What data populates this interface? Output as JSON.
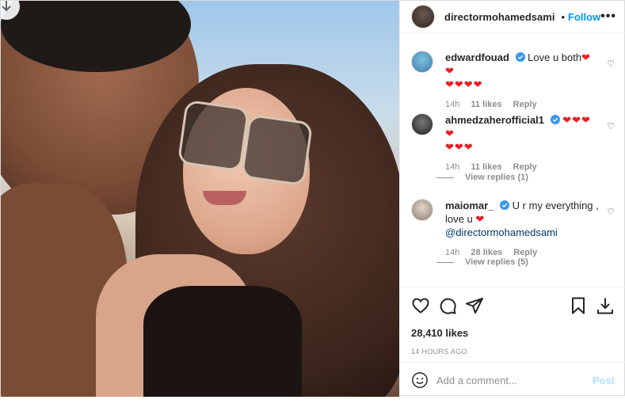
{
  "header": {
    "username": "directormohamedsami",
    "dot": "•",
    "follow_label": "Follow",
    "more_label": "•••"
  },
  "comments": [
    {
      "username": "edwardfouad",
      "text": "Love u both",
      "hearts_inline": "❤❤",
      "hearts_line2": "❤❤❤❤",
      "time": "14h",
      "likes": "11 likes",
      "reply": "Reply",
      "avatar_color": "#5aa0c8"
    },
    {
      "username": "ahmedzaherofficial1",
      "hearts_inline": "❤❤❤❤",
      "hearts_line2": "❤❤❤",
      "time": "14h",
      "likes": "11 likes",
      "reply": "Reply",
      "view_replies": "View replies (1)",
      "avatar_color": "#3a3a3a"
    },
    {
      "username": "maiomar_",
      "text": "U r my everything ,",
      "text2": "love u",
      "heart2": "❤",
      "mention": "@directormohamedsami",
      "time": "14h",
      "likes": "28 likes",
      "reply": "Reply",
      "view_replies": "View replies (5)",
      "avatar_color": "#c9b8a8"
    }
  ],
  "likes_count": "28,410 likes",
  "timestamp": "14 HOURS AGO",
  "add_comment": {
    "placeholder": "Add a comment...",
    "post_label": "Post"
  },
  "colors": {
    "accent": "#0095f6",
    "heart": "#ed1c24",
    "muted": "#8e8e8e"
  }
}
